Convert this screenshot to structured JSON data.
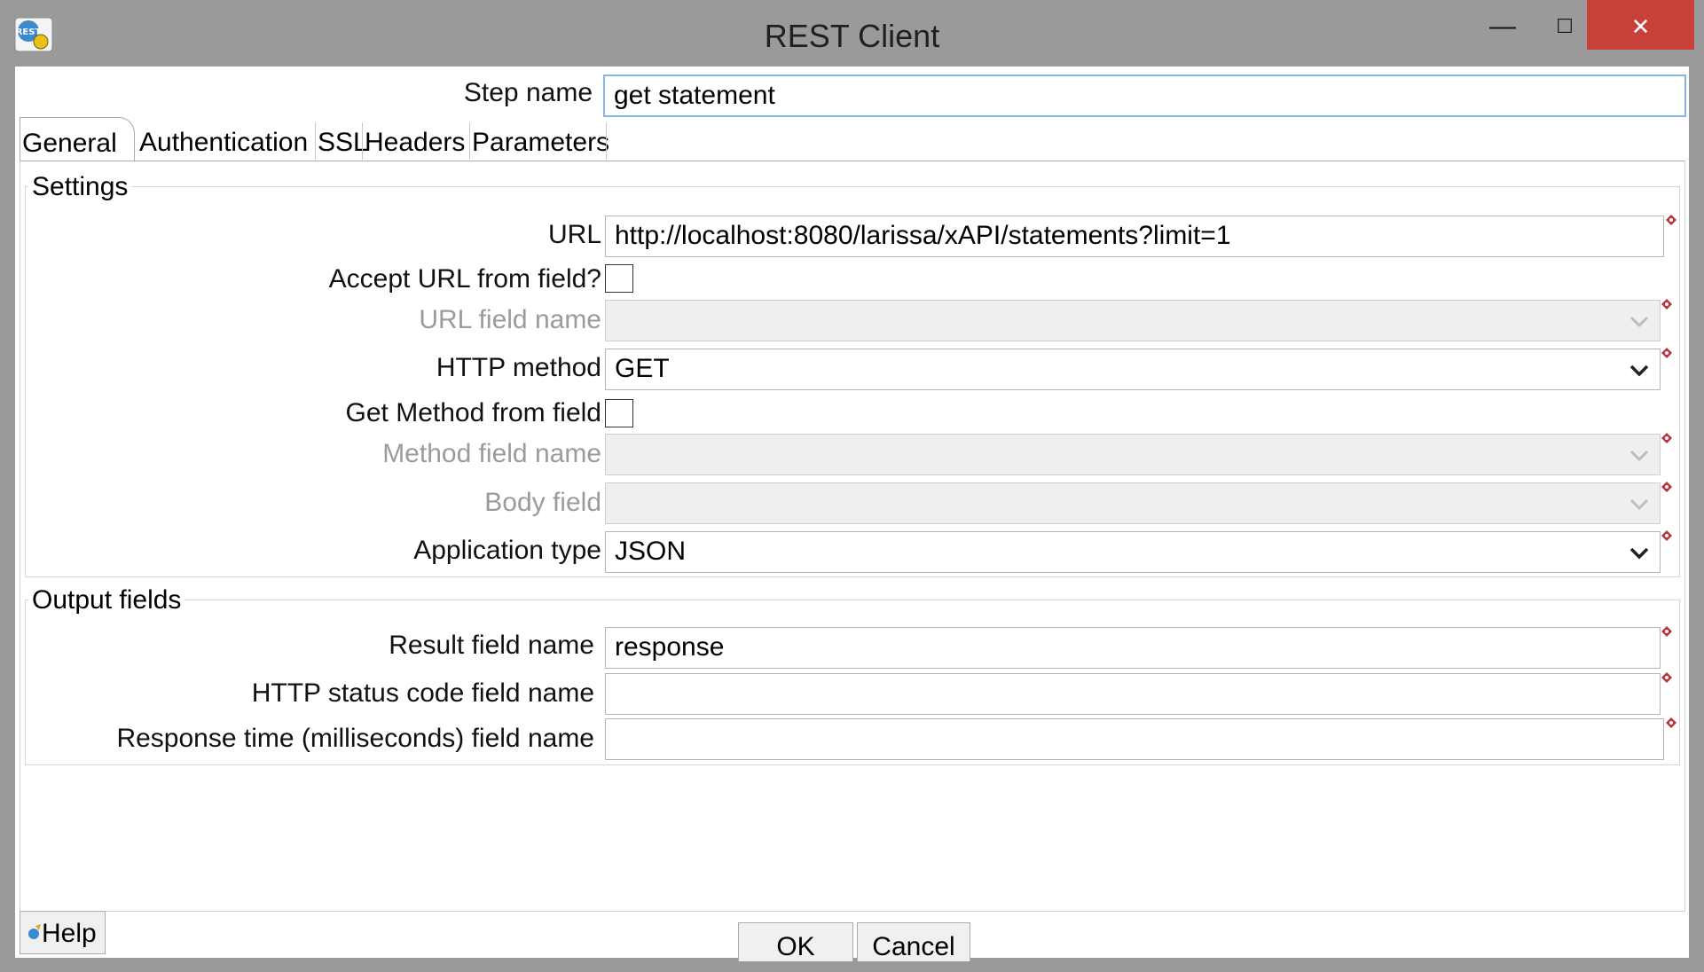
{
  "window": {
    "title": "REST Client",
    "icon": "rest-client-icon",
    "controls": {
      "minimize": "minimize-icon",
      "maximize": "maximize-icon",
      "close": "close-icon"
    },
    "close_color": "#c7413a"
  },
  "step": {
    "label": "Step name",
    "value": "get statement"
  },
  "tabs": [
    {
      "label": "General",
      "active": true
    },
    {
      "label": "Authentication"
    },
    {
      "label": "SSL"
    },
    {
      "label": "Headers"
    },
    {
      "label": "Parameters"
    }
  ],
  "settings": {
    "title": "Settings",
    "url": {
      "label": "URL",
      "value": "http://localhost:8080/larissa/xAPI/statements?limit=1"
    },
    "accept_url_from_field": {
      "label": "Accept URL from field?",
      "checked": false
    },
    "url_field_name": {
      "label": "URL field name",
      "value": "",
      "enabled": false
    },
    "http_method": {
      "label": "HTTP method",
      "value": "GET"
    },
    "get_method_from_field": {
      "label": "Get Method from field",
      "checked": false
    },
    "method_field_name": {
      "label": "Method field name",
      "value": "",
      "enabled": false
    },
    "body_field": {
      "label": "Body field",
      "value": "",
      "enabled": false
    },
    "application_type": {
      "label": "Application type",
      "value": "JSON"
    }
  },
  "output": {
    "title": "Output fields",
    "result_field_name": {
      "label": "Result field name",
      "value": "response"
    },
    "http_status_code_field_name": {
      "label": "HTTP status code field name",
      "value": ""
    },
    "response_time_field_name": {
      "label": "Response time (milliseconds) field name",
      "value": ""
    }
  },
  "buttons": {
    "help": "Help",
    "ok": "OK",
    "cancel": "Cancel"
  }
}
